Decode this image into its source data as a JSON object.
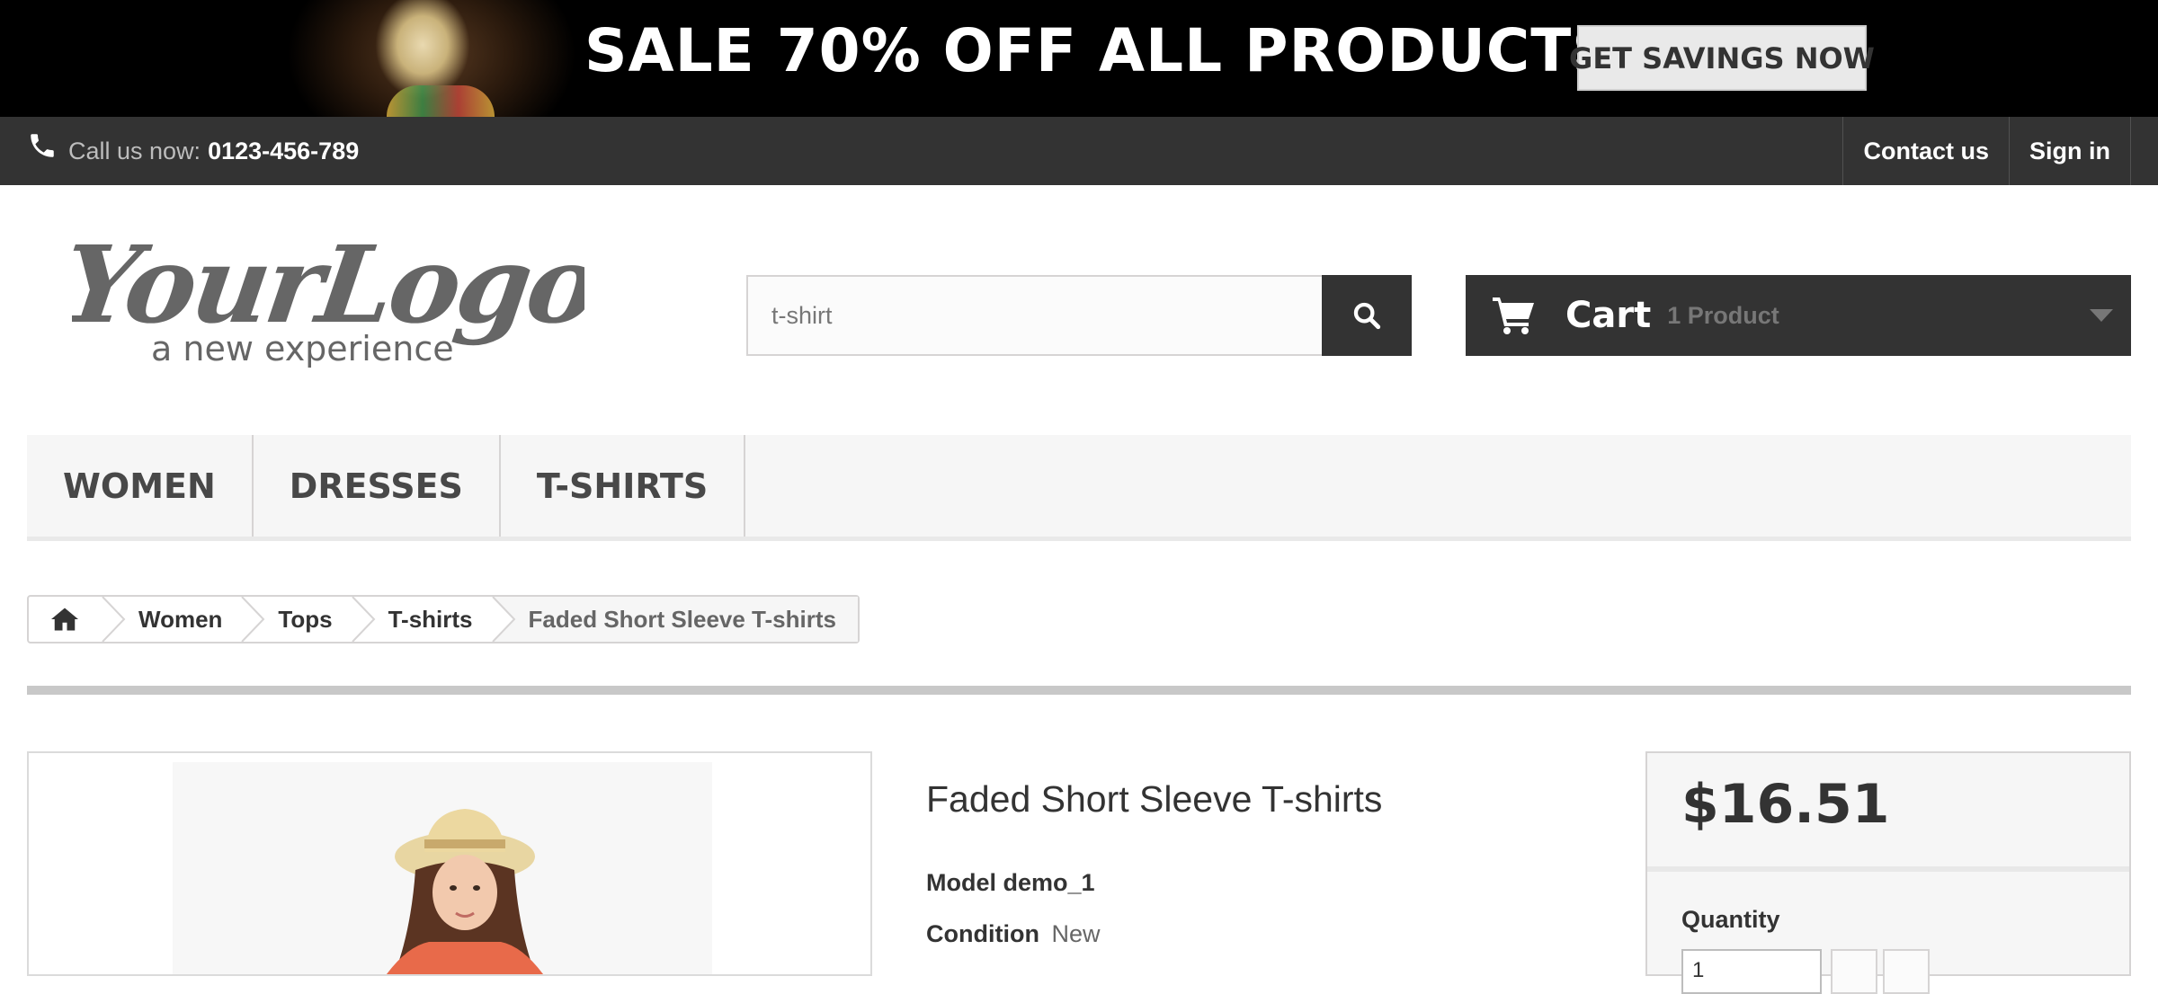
{
  "banner": {
    "headline": "SALE 70% OFF ALL PRODUCTS",
    "cta_label": "GET SAVINGS NOW"
  },
  "nav": {
    "call_us_label": "Call us now:",
    "phone_number": "0123-456-789",
    "contact_label": "Contact us",
    "signin_label": "Sign in"
  },
  "header": {
    "logo_text": "YourLogo",
    "logo_tagline": "a new experience",
    "search_value": "t-shirt",
    "cart_label": "Cart",
    "cart_count": "1 Product"
  },
  "menu": {
    "items": [
      {
        "label": "WOMEN"
      },
      {
        "label": "DRESSES"
      },
      {
        "label": "T-SHIRTS"
      }
    ]
  },
  "breadcrumb": {
    "items": [
      "Women",
      "Tops",
      "T-shirts"
    ],
    "current": "Faded Short Sleeve T-shirts"
  },
  "product": {
    "title": "Faded Short Sleeve T-shirts",
    "model_label": "Model demo_1",
    "condition_label": "Condition",
    "condition_value": "New",
    "price": "$16.51",
    "quantity_label": "Quantity",
    "quantity_value": "1"
  },
  "colors": {
    "dark_bar": "#333333",
    "menu_bg": "#f6f6f6",
    "border": "#d6d4d4"
  }
}
